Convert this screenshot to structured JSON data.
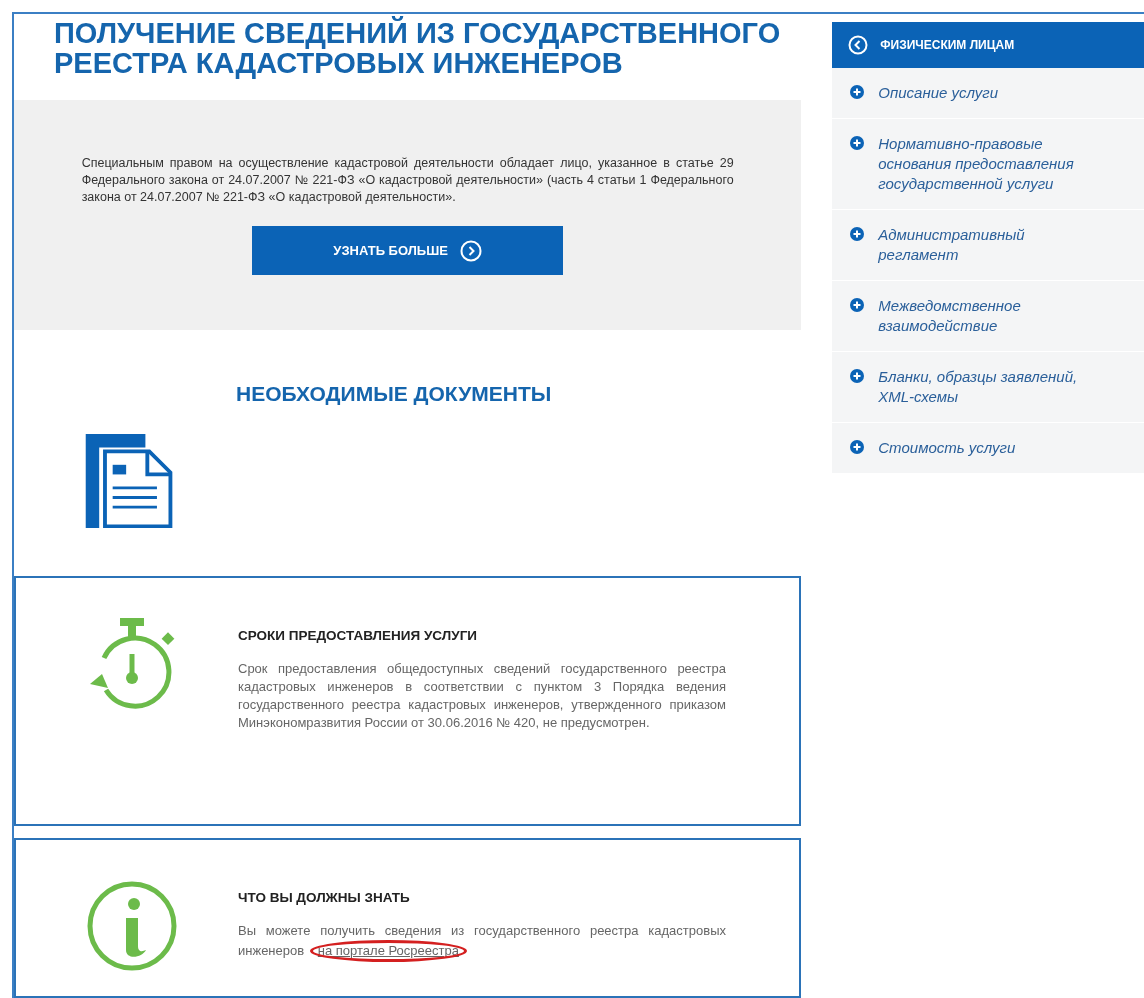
{
  "title": "ПОЛУЧЕНИЕ СВЕДЕНИЙ ИЗ ГОСУДАРСТВЕННОГО РЕЕСТРА КАДАСТРОВЫХ ИНЖЕНЕРОВ",
  "intro": {
    "text": "Специальным правом на осуществление кадастровой деятельности обладает лицо, указанное в статье 29 Федерального закона от 24.07.2007 №  221-ФЗ «О кадастровой деятельности» (часть 4 статьи 1 Федерального закона от 24.07.2007 № 221-ФЗ «О кадастровой деятельности».",
    "button": "УЗНАТЬ БОЛЬШЕ"
  },
  "documents": {
    "heading": "НЕОБХОДИМЫЕ ДОКУМЕНТЫ"
  },
  "cards": [
    {
      "kind": "timer",
      "heading": "СРОКИ ПРЕДОСТАВЛЕНИЯ УСЛУГИ",
      "text": "Срок предоставления общедоступных сведений государственного реестра кадастровых инженеров в соответствии с пунктом 3 Порядка ведения государственного реестра кадастровых инженеров, утвержденного приказом Минэкономразвития России от 30.06.2016 №  420, не предусмотрен."
    },
    {
      "kind": "info",
      "heading": "ЧТО ВЫ ДОЛЖНЫ ЗНАТЬ",
      "text": "Вы можете получить сведения из государственного реестра кадастровых инженеров",
      "link": {
        "label": "на портале Росреестра",
        "highlighted": true
      }
    }
  ],
  "sidebar": {
    "header": "ФИЗИЧЕСКИМ ЛИЦАМ",
    "items": [
      {
        "label": "Описание услуги"
      },
      {
        "label": "Нормативно-правовые основания предоставления государственной услуги"
      },
      {
        "label": "Административный регламент"
      },
      {
        "label": "Межведомственное взаимодействие"
      },
      {
        "label": "Бланки, образцы заявлений, XML-схемы"
      },
      {
        "label": "Стоимость услуги"
      }
    ]
  }
}
